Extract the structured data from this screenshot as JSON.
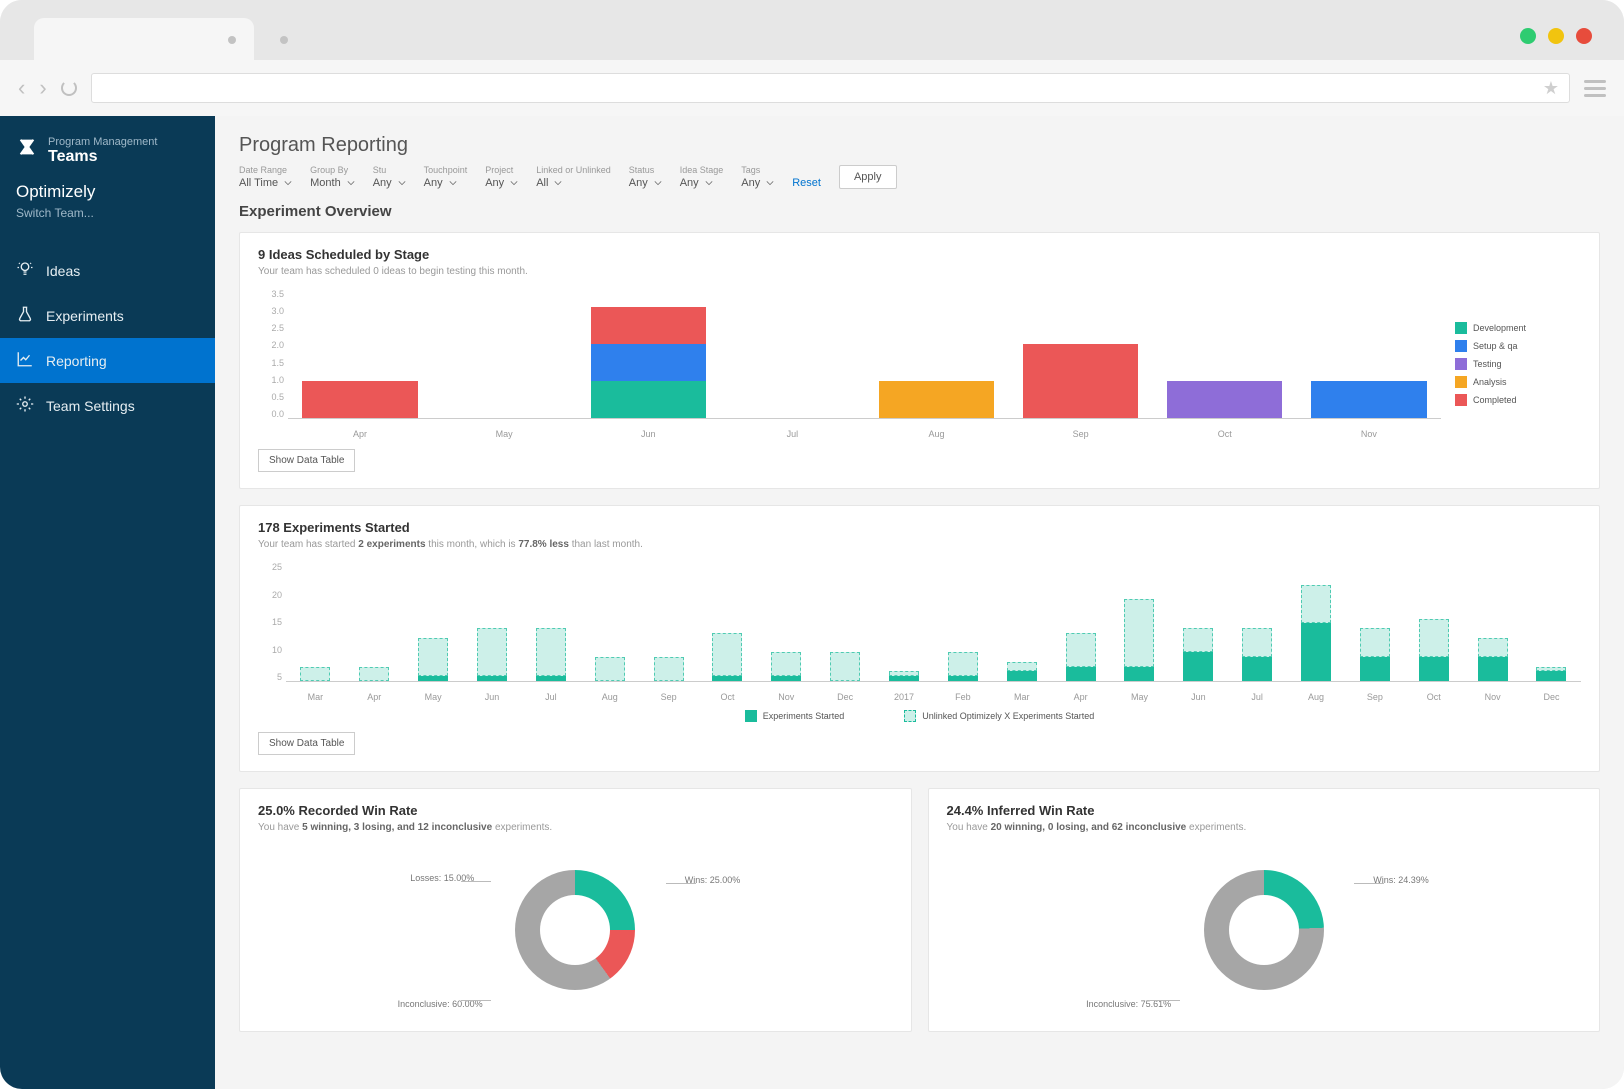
{
  "colors": {
    "development": "#1abc9c",
    "setup": "#2f80ed",
    "testing": "#8e6dd8",
    "analysis": "#f5a623",
    "completed": "#eb5757",
    "hatch": "rgba(26,188,156,0.22)",
    "grey": "#a6a6a6"
  },
  "sidebar": {
    "product_line": "Program Management",
    "product_name": "Teams",
    "team": "Optimizely",
    "switch": "Switch Team...",
    "items": [
      {
        "label": "Ideas",
        "icon": "lightbulb"
      },
      {
        "label": "Experiments",
        "icon": "flask"
      },
      {
        "label": "Reporting",
        "icon": "chart",
        "active": true
      },
      {
        "label": "Team Settings",
        "icon": "gear"
      }
    ]
  },
  "page": {
    "title": "Program Reporting",
    "section": "Experiment Overview"
  },
  "filters": {
    "items": [
      {
        "label": "Date Range",
        "value": "All Time"
      },
      {
        "label": "Group By",
        "value": "Month"
      },
      {
        "label": "Stu",
        "value": "Any"
      },
      {
        "label": "Touchpoint",
        "value": "Any"
      },
      {
        "label": "Project",
        "value": "Any"
      },
      {
        "label": "Linked or Unlinked",
        "value": "All"
      },
      {
        "label": "Status",
        "value": "Any"
      },
      {
        "label": "Idea Stage",
        "value": "Any"
      },
      {
        "label": "Tags",
        "value": "Any"
      }
    ],
    "reset": "Reset",
    "apply": "Apply"
  },
  "card1": {
    "title": "9 Ideas Scheduled by Stage",
    "subtitle": "Your team has scheduled 0 ideas to begin testing this month.",
    "button": "Show Data Table",
    "legend": [
      {
        "label": "Development",
        "color": "#1abc9c"
      },
      {
        "label": "Setup & qa",
        "color": "#2f80ed"
      },
      {
        "label": "Testing",
        "color": "#8e6dd8"
      },
      {
        "label": "Analysis",
        "color": "#f5a623"
      },
      {
        "label": "Completed",
        "color": "#eb5757"
      }
    ]
  },
  "card2": {
    "title": "178 Experiments Started",
    "sub_pre": "Your team has started ",
    "sub_b1": "2 experiments",
    "sub_mid": " this month, which is ",
    "sub_b2": "77.8% less",
    "sub_post": " than last month.",
    "button": "Show Data Table",
    "legend_a": "Experiments Started",
    "legend_b": "Unlinked Optimizely X Experiments Started"
  },
  "card3": {
    "title": "25.0% Recorded Win Rate",
    "sub_pre": "You have ",
    "sub_bold": "5 winning, 3 losing, and 12 inconclusive",
    "sub_post": " experiments.",
    "labels": {
      "wins": "Wins: 25.00%",
      "losses": "Losses: 15.00%",
      "inconclusive": "Inconclusive: 60.00%"
    }
  },
  "card4": {
    "title": "24.4% Inferred Win Rate",
    "sub_pre": "You have ",
    "sub_bold": "20 winning, 0 losing, and 62 inconclusive",
    "sub_post": " experiments.",
    "labels": {
      "wins": "Wins: 24.39%",
      "inconclusive": "Inconclusive: 75.61%"
    }
  },
  "chart_data": [
    {
      "id": "ideas-by-stage",
      "type": "bar",
      "stacked": true,
      "categories": [
        "Apr",
        "May",
        "Jun",
        "Jul",
        "Aug",
        "Sep",
        "Oct",
        "Nov"
      ],
      "ylim": [
        0,
        3.5
      ],
      "yticks": [
        "3.5",
        "3.0",
        "2.5",
        "2.0",
        "1.5",
        "1.0",
        "0.5",
        "0.0"
      ],
      "series": [
        {
          "name": "Development",
          "color": "#1abc9c",
          "values": [
            0,
            0,
            1,
            0,
            0,
            0,
            0,
            0
          ]
        },
        {
          "name": "Setup & qa",
          "color": "#2f80ed",
          "values": [
            0,
            0,
            1,
            0,
            0,
            0,
            0,
            1
          ]
        },
        {
          "name": "Testing",
          "color": "#8e6dd8",
          "values": [
            0,
            0,
            0,
            0,
            0,
            0,
            1,
            0
          ]
        },
        {
          "name": "Analysis",
          "color": "#f5a623",
          "values": [
            0,
            0,
            0,
            0,
            1,
            0,
            0,
            0
          ]
        },
        {
          "name": "Completed",
          "color": "#eb5757",
          "values": [
            1,
            0,
            1,
            0,
            0,
            2,
            0,
            0
          ]
        }
      ]
    },
    {
      "id": "experiments-started",
      "type": "bar",
      "stacked": true,
      "categories": [
        "Mar",
        "Apr",
        "May",
        "Jun",
        "Jul",
        "Aug",
        "Sep",
        "Oct",
        "Nov",
        "Dec",
        "2017",
        "Feb",
        "Mar",
        "Apr",
        "May",
        "Jun",
        "Jul",
        "Aug",
        "Sep",
        "Oct",
        "Nov",
        "Dec"
      ],
      "ylim": [
        0,
        25
      ],
      "yticks": [
        "25",
        "20",
        "15",
        "10",
        "5"
      ],
      "series": [
        {
          "name": "Experiments Started",
          "color": "#1abc9c",
          "values": [
            0,
            0,
            1,
            1,
            1,
            0,
            0,
            1,
            1,
            0,
            1,
            1,
            2,
            3,
            3,
            6,
            5,
            12,
            5,
            5,
            5,
            2
          ]
        },
        {
          "name": "Unlinked Optimizely X Experiments Started",
          "color": "rgba(26,188,156,0.22)",
          "hatched": true,
          "values": [
            3,
            3,
            8,
            10,
            10,
            5,
            5,
            9,
            5,
            6,
            1,
            5,
            2,
            7,
            14,
            5,
            6,
            8,
            6,
            8,
            4,
            1
          ]
        }
      ]
    },
    {
      "id": "recorded-win-rate",
      "type": "pie",
      "donut": true,
      "series": [
        {
          "name": "Wins",
          "value": 25.0,
          "color": "#1abc9c"
        },
        {
          "name": "Losses",
          "value": 15.0,
          "color": "#eb5757"
        },
        {
          "name": "Inconclusive",
          "value": 60.0,
          "color": "#a6a6a6"
        }
      ]
    },
    {
      "id": "inferred-win-rate",
      "type": "pie",
      "donut": true,
      "series": [
        {
          "name": "Wins",
          "value": 24.39,
          "color": "#1abc9c"
        },
        {
          "name": "Inconclusive",
          "value": 75.61,
          "color": "#a6a6a6"
        }
      ]
    }
  ]
}
